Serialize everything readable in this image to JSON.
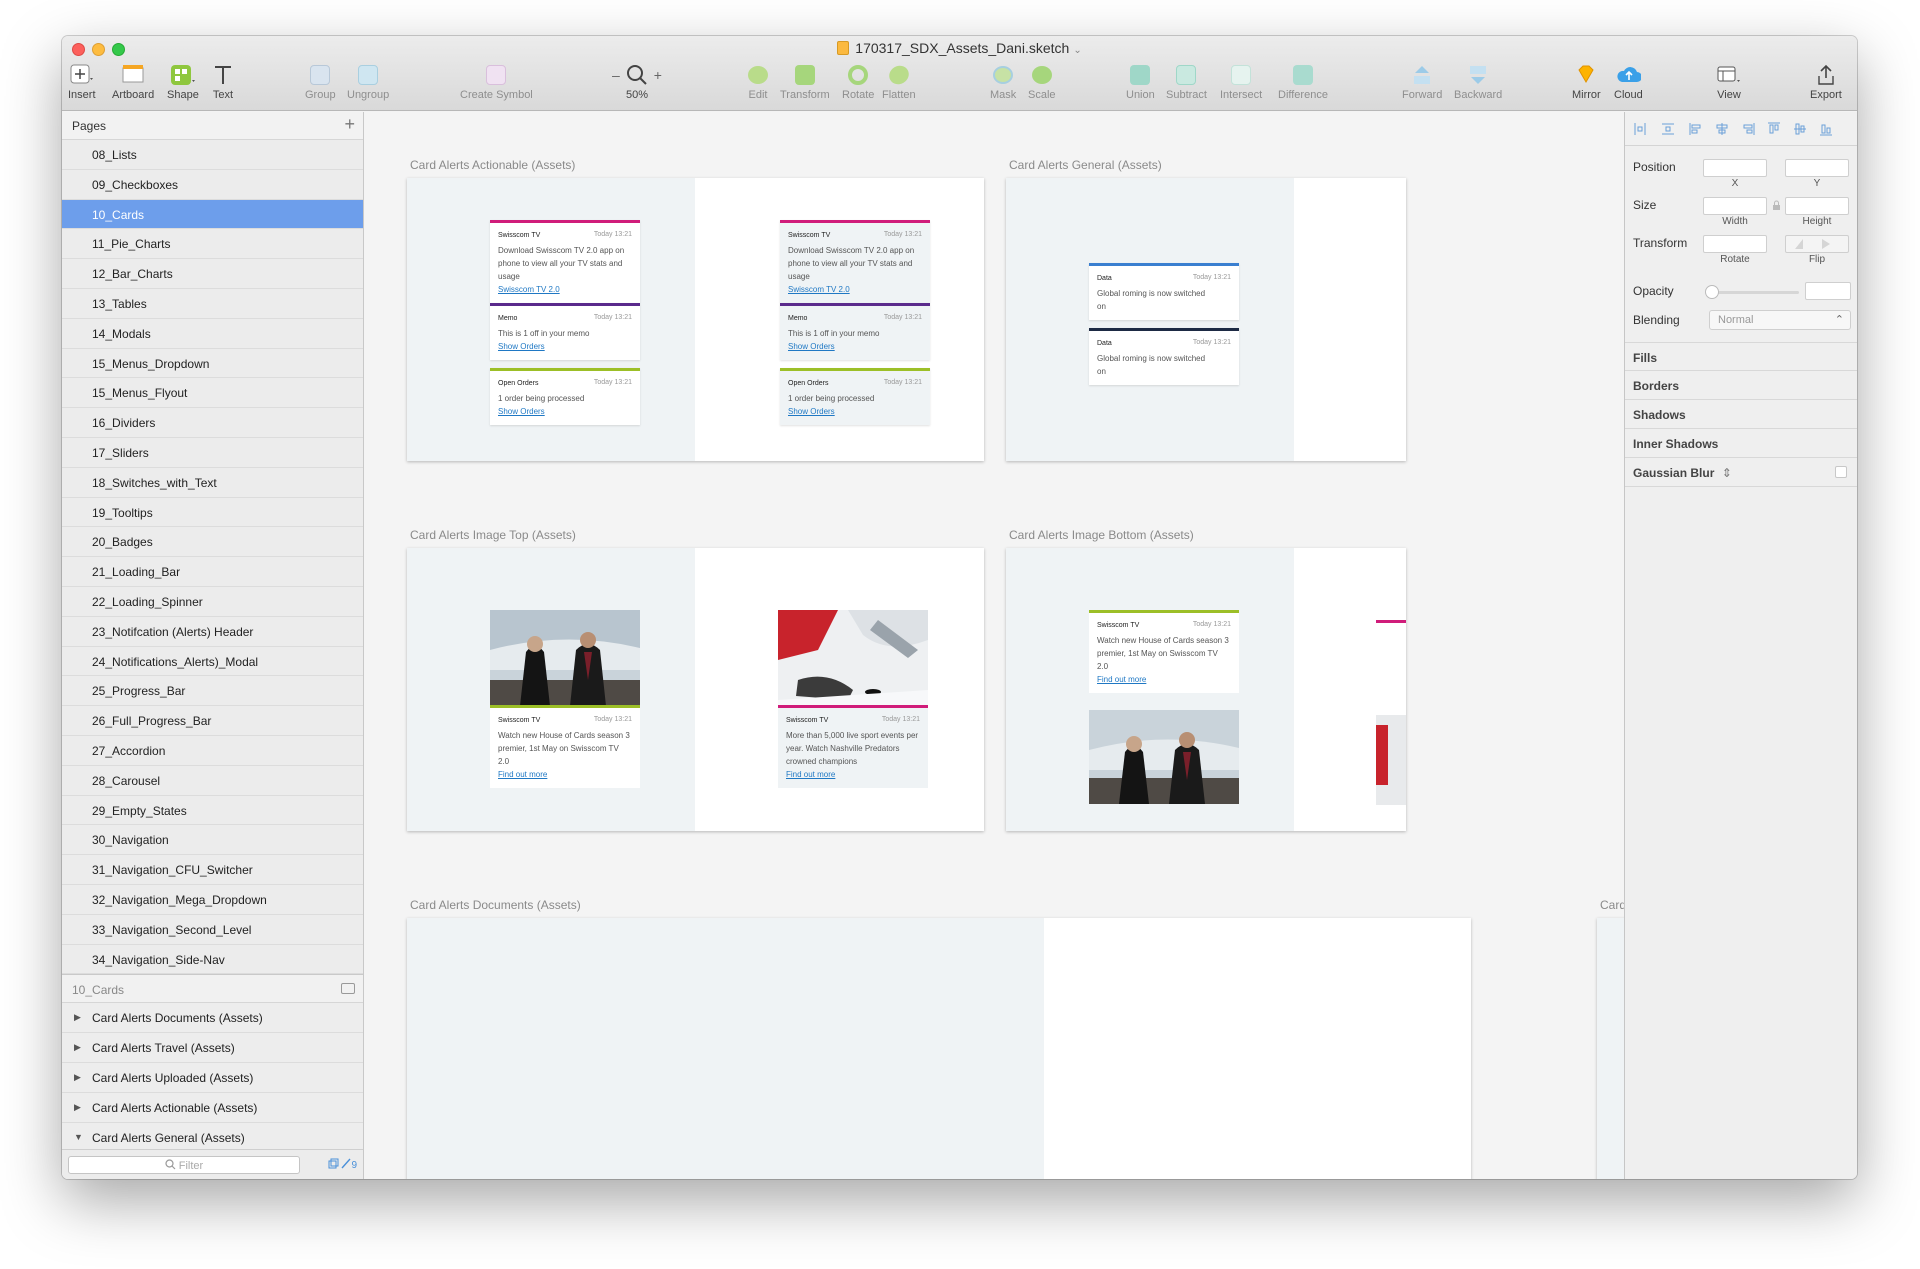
{
  "window": {
    "title": "170317_SDX_Assets_Dani.sketch",
    "title_chevron": "⌄"
  },
  "toolbar": {
    "insert": "Insert",
    "artboard": "Artboard",
    "shape": "Shape",
    "text": "Text",
    "group": "Group",
    "ungroup": "Ungroup",
    "create_symbol": "Create Symbol",
    "zoom_minus": "–",
    "zoom_plus": "+",
    "zoom": "50%",
    "edit": "Edit",
    "transform": "Transform",
    "rotate": "Rotate",
    "flatten": "Flatten",
    "mask": "Mask",
    "scale": "Scale",
    "union": "Union",
    "subtract": "Subtract",
    "intersect": "Intersect",
    "difference": "Difference",
    "forward": "Forward",
    "backward": "Backward",
    "mirror": "Mirror",
    "cloud": "Cloud",
    "view": "View",
    "export": "Export"
  },
  "pages": {
    "header": "Pages",
    "add": "+",
    "items": [
      "08_Lists",
      "09_Checkboxes",
      "10_Cards",
      "11_Pie_Charts",
      "12_Bar_Charts",
      "13_Tables",
      "14_Modals",
      "15_Menus_Dropdown",
      "15_Menus_Flyout",
      "16_Dividers",
      "17_Sliders",
      "18_Switches_with_Text",
      "19_Tooltips",
      "20_Badges",
      "21_Loading_Bar",
      "22_Loading_Spinner",
      "23_Notifcation (Alerts) Header",
      "24_Notifications_Alerts)_Modal",
      "25_Progress_Bar",
      "26_Full_Progress_Bar",
      "27_Accordion",
      "28_Carousel",
      "29_Empty_States",
      "30_Navigation",
      "31_Navigation_CFU_Switcher",
      "32_Navigation_Mega_Dropdown",
      "33_Navigation_Second_Level",
      "34_Navigation_Side-Nav"
    ],
    "selected_index": 2
  },
  "layers": {
    "header": "10_Cards",
    "items": [
      {
        "label": "Card Alerts Documents (Assets)",
        "arrow": "▶"
      },
      {
        "label": "Card Alerts Travel (Assets)",
        "arrow": "▶"
      },
      {
        "label": "Card Alerts Uploaded (Assets)",
        "arrow": "▶"
      },
      {
        "label": "Card Alerts Actionable (Assets)",
        "arrow": "▶"
      },
      {
        "label": "Card Alerts General (Assets)",
        "arrow": "▼"
      }
    ],
    "filter_placeholder": "Filter",
    "filter_badge": "9"
  },
  "canvas": {
    "artboards": {
      "actionable": "Card Alerts Actionable (Assets)",
      "general": "Card Alerts General (Assets)",
      "image_top": "Card Alerts Image Top (Assets)",
      "image_bottom": "Card Alerts Image Bottom (Assets)",
      "documents": "Card Alerts Documents (Assets)",
      "travel": "Card Alerts Tra"
    },
    "cards": {
      "tv_title": "Swisscom TV",
      "time": "Today 13:21",
      "tv_body": "Download Swisscom TV 2.0 app on phone to view all your TV stats and usage",
      "tv_link": "Swisscom TV 2.0",
      "memo_title": "Memo",
      "memo_body": "This is 1 off in your memo",
      "memo_link": "Show Orders",
      "orders_title": "Open Orders",
      "orders_body": "1 order being processed",
      "orders_link": "Show Orders",
      "data_title": "Data",
      "data_body": "Global roming is now switched on",
      "hoc_body": "Watch new House of Cards season 3 premier, 1st May on Swisscom TV 2.0",
      "sport_body": "More than 5,000 live sport events per year. Watch Nashville Predators crowned champions",
      "find_more": "Find out more"
    },
    "colors": {
      "magenta": "#d01c7a",
      "purple": "#5a2a8c",
      "lime": "#9cbf27",
      "blue": "#3a7fd0",
      "navy": "#1d2a44"
    }
  },
  "inspector": {
    "position": "Position",
    "x": "X",
    "y": "Y",
    "size": "Size",
    "width": "Width",
    "height": "Height",
    "transform": "Transform",
    "rotate": "Rotate",
    "flip": "Flip",
    "opacity": "Opacity",
    "blending": "Blending",
    "blending_value": "Normal",
    "fills": "Fills",
    "borders": "Borders",
    "shadows": "Shadows",
    "inner_shadows": "Inner Shadows",
    "gaussian_blur": "Gaussian Blur"
  }
}
